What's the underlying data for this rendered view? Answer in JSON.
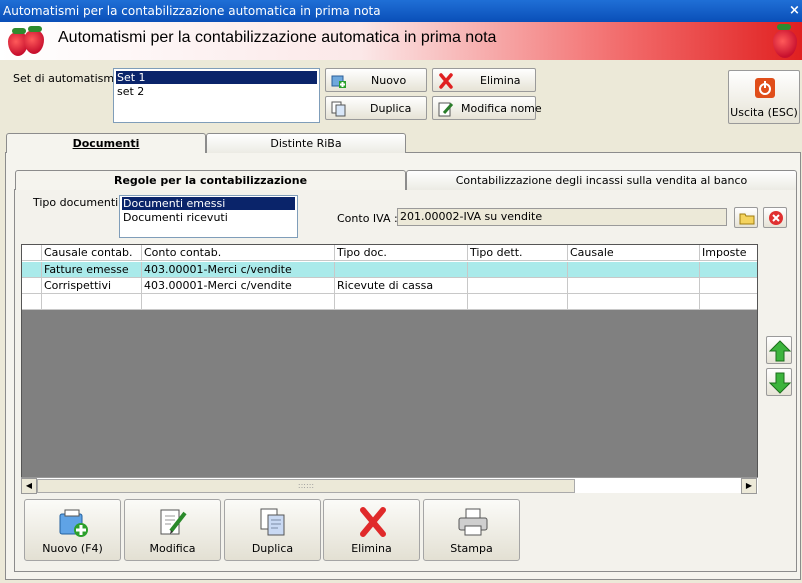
{
  "window": {
    "title": "Automatismi per la contabilizzazione automatica in prima nota",
    "close_glyph": "×"
  },
  "header": {
    "title": "Automatismi per la contabilizzazione automatica in prima nota",
    "logo_icon": "strawberry-icon"
  },
  "set": {
    "label": "Set di automatismi :",
    "items": [
      {
        "label": "Set 1",
        "selected": true
      },
      {
        "label": "set 2",
        "selected": false
      }
    ]
  },
  "toolbar": {
    "nuovo": "Nuovo",
    "elimina": "Elimina",
    "duplica": "Duplica",
    "modifica_nome": "Modifica nome",
    "uscita": "Uscita (ESC)"
  },
  "tabs": [
    {
      "label": "Documenti",
      "active": true
    },
    {
      "label": "Distinte RiBa",
      "active": false
    }
  ],
  "subtabs": [
    {
      "label": "Regole per la contabilizzazione",
      "active": true
    },
    {
      "label": "Contabilizzazione degli incassi sulla vendita al banco",
      "active": false
    }
  ],
  "tipo_documenti": {
    "label": "Tipo documenti :",
    "items": [
      {
        "label": "Documenti emessi",
        "selected": true
      },
      {
        "label": "Documenti ricevuti",
        "selected": false
      }
    ]
  },
  "conto_iva": {
    "label": "Conto IVA :",
    "value": "201.00002-IVA su vendite"
  },
  "grid": {
    "columns": [
      "Causale contab.",
      "Conto contab.",
      "Tipo doc.",
      "Tipo dett.",
      "Causale",
      "Imposte"
    ],
    "rows": [
      {
        "cells": [
          "Fatture emesse",
          "403.00001-Merci c/vendite",
          "",
          "",
          "",
          ""
        ],
        "highlight": true
      },
      {
        "cells": [
          "Corrispettivi",
          "403.00001-Merci c/vendite",
          "Ricevute di cassa",
          "",
          "",
          ""
        ],
        "highlight": false
      },
      {
        "cells": [
          "",
          "",
          "",
          "",
          "",
          ""
        ],
        "highlight": false
      }
    ]
  },
  "bottom_buttons": [
    {
      "label": "Nuovo (F4)",
      "icon": "new-document-icon"
    },
    {
      "label": "Modifica",
      "icon": "edit-icon"
    },
    {
      "label": "Duplica",
      "icon": "duplicate-icon"
    },
    {
      "label": "Elimina",
      "icon": "delete-icon"
    },
    {
      "label": "Stampa",
      "icon": "printer-icon"
    }
  ],
  "side_buttons": [
    {
      "icon": "arrow-up-icon"
    },
    {
      "icon": "arrow-down-icon"
    }
  ]
}
